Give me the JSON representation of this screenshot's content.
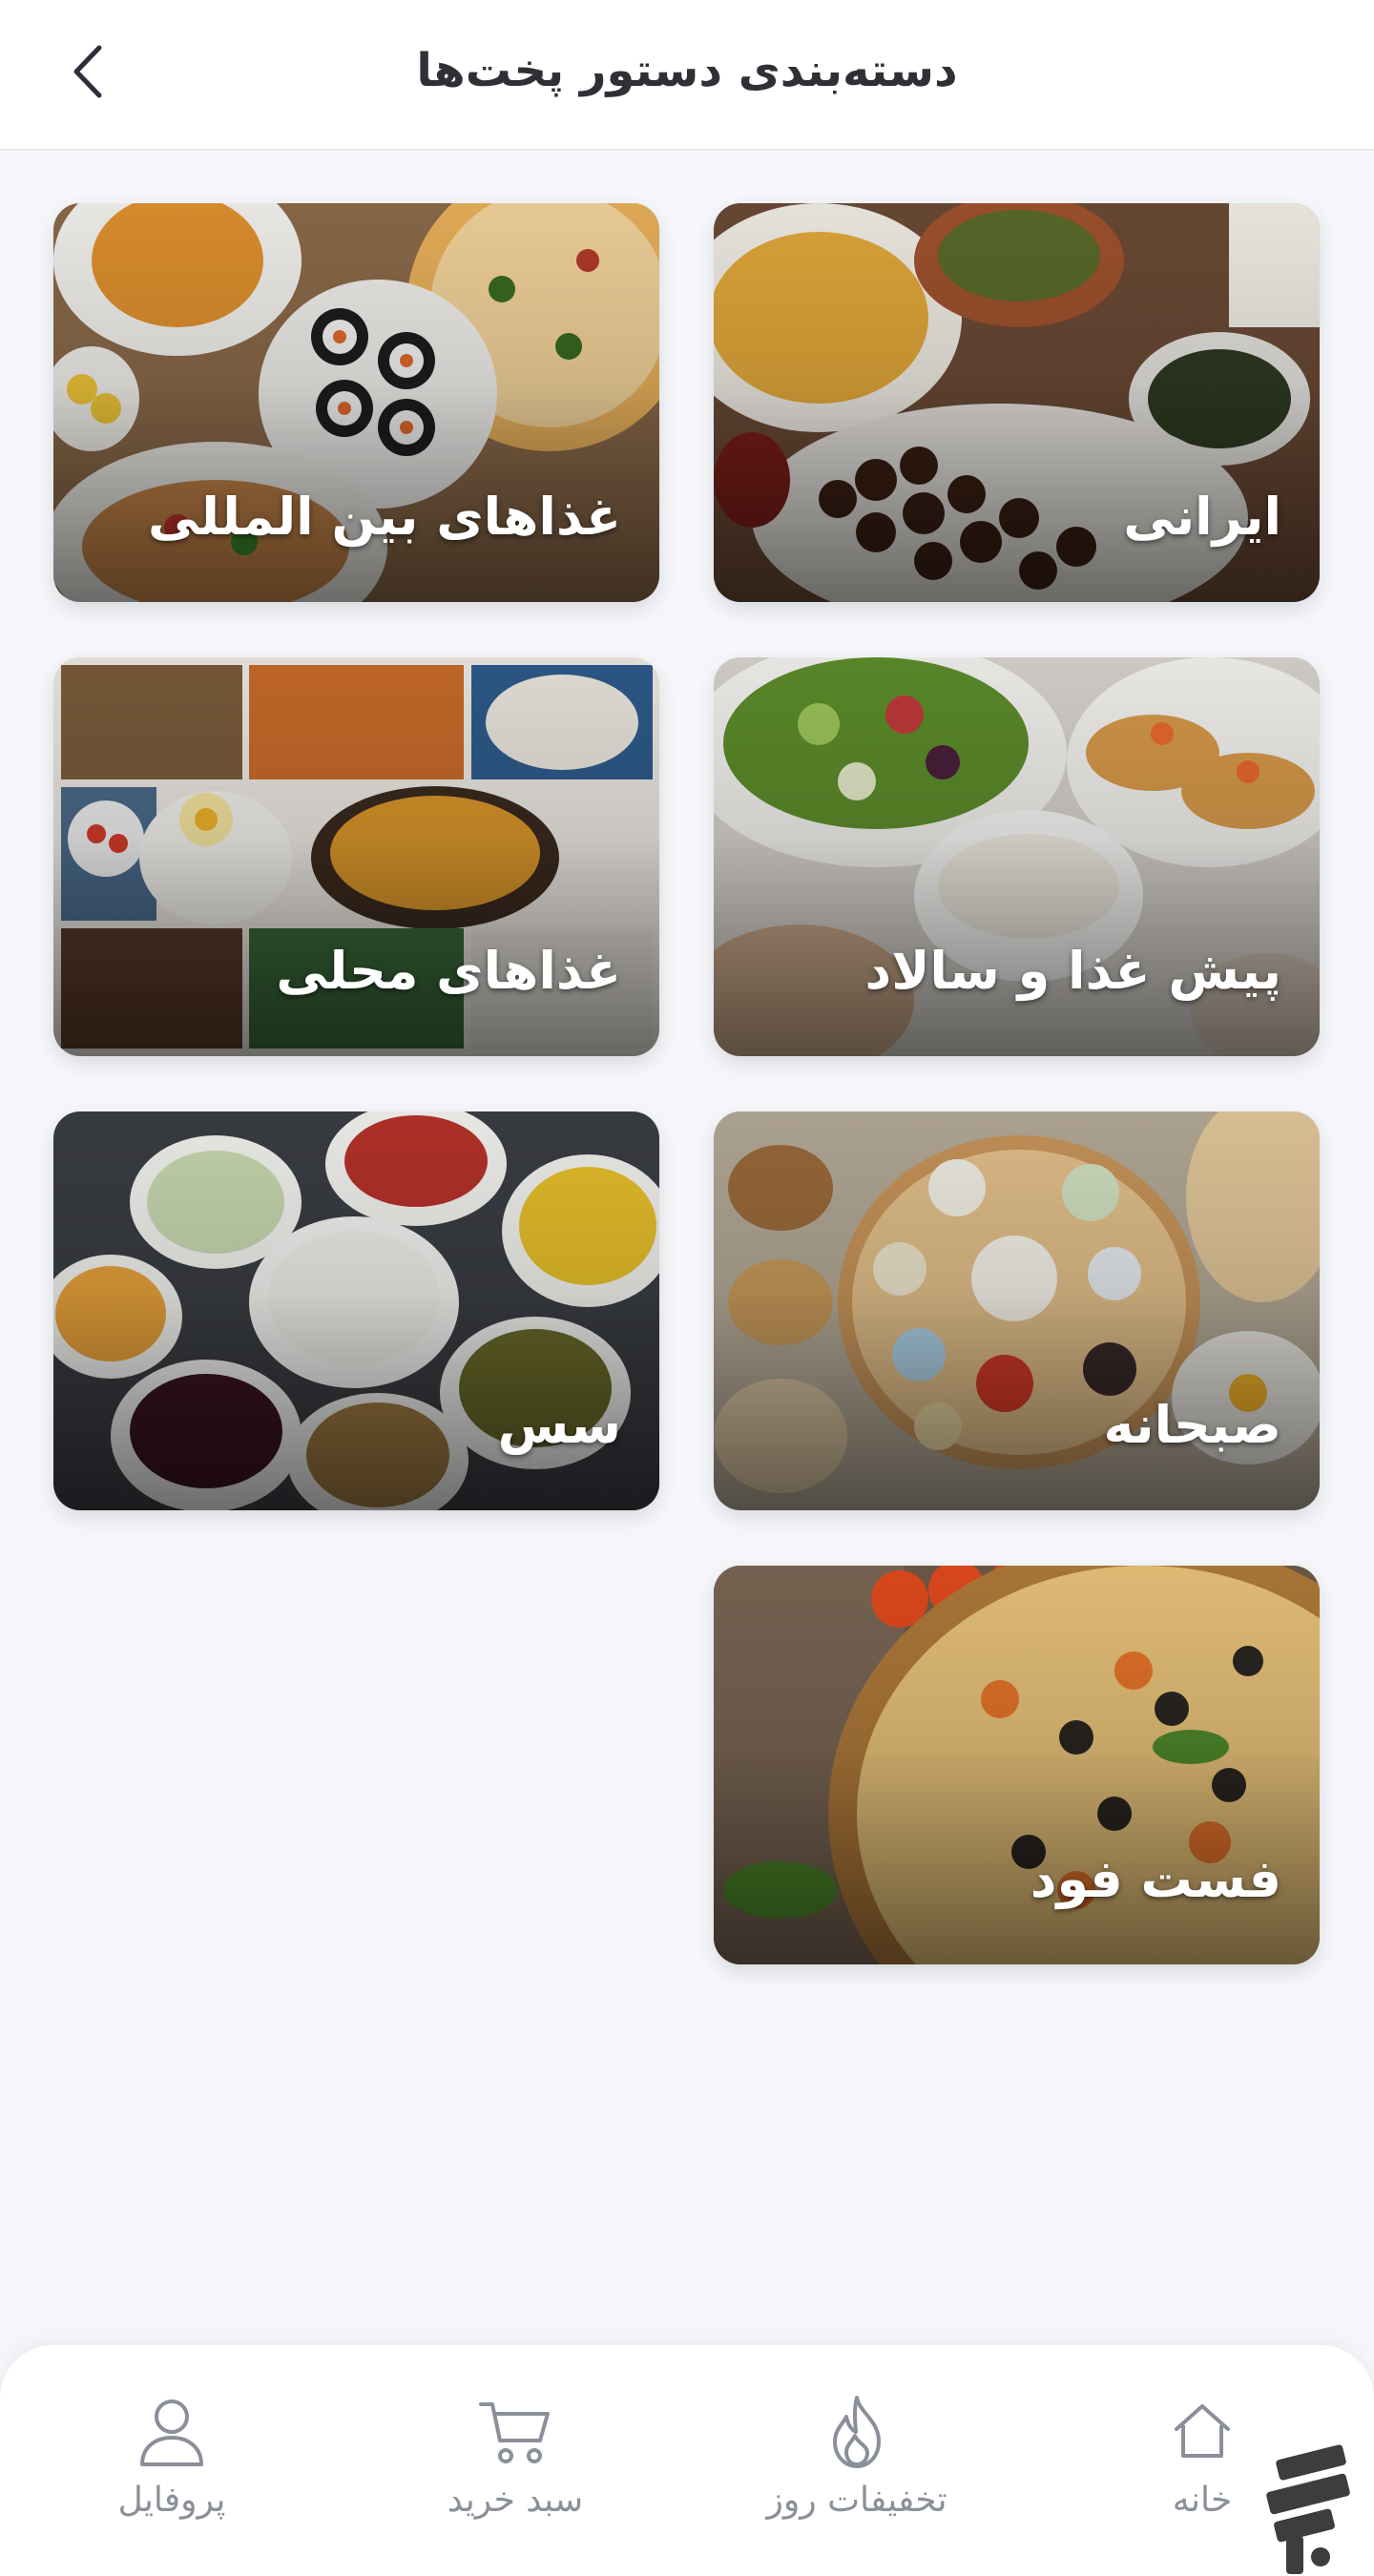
{
  "header": {
    "title": "دسته‌بندی دستور پخت‌ها"
  },
  "categories": [
    {
      "label": "ایرانی"
    },
    {
      "label": "غذاهای بین المللی"
    },
    {
      "label": "پیش غذا و سالاد"
    },
    {
      "label": "غذاهای محلی"
    },
    {
      "label": "صبحانه"
    },
    {
      "label": "سس"
    },
    {
      "label": "فست فود"
    }
  ],
  "bottom_nav": {
    "items": [
      {
        "label": "خانه",
        "icon": "home-icon"
      },
      {
        "label": "تخفیفات روز",
        "icon": "flame-icon"
      },
      {
        "label": "سبد خرید",
        "icon": "cart-icon"
      },
      {
        "label": "پروفایل",
        "icon": "user-icon"
      }
    ]
  },
  "colors": {
    "background": "#f5f7fa",
    "header_text": "#2f2f36",
    "nav_label": "#8a8f99",
    "watermark": "#444444"
  }
}
